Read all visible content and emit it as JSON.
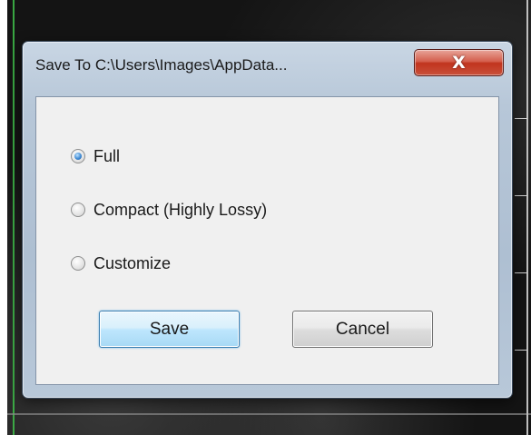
{
  "dialog": {
    "title": "Save To C:\\Users\\Images\\AppData...",
    "close_label": "X",
    "options": [
      {
        "label": "Full",
        "checked": true
      },
      {
        "label": "Compact (Highly Lossy)",
        "checked": false
      },
      {
        "label": "Customize",
        "checked": false
      }
    ],
    "save_label": "Save",
    "cancel_label": "Cancel"
  },
  "colors": {
    "close_button": "#c9503a",
    "save_button_border": "#3c7fb1",
    "radio_selected": "#3f8ad3",
    "client_background": "#f0f0f0"
  }
}
